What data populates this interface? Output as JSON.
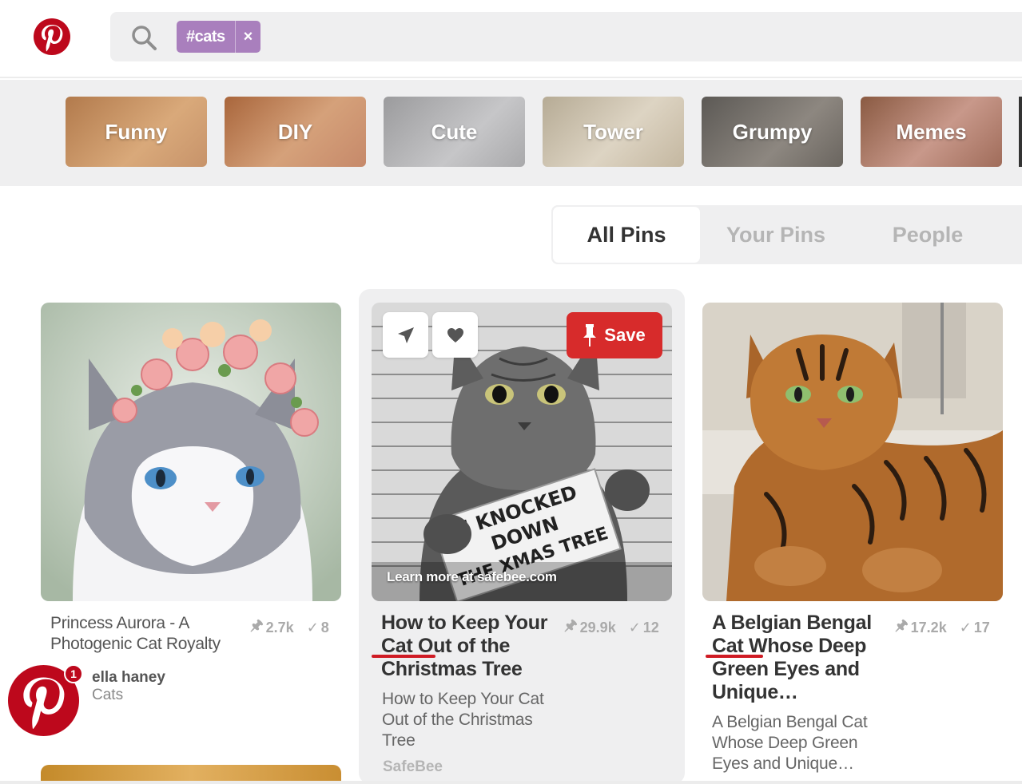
{
  "colors": {
    "brand": "#bd081c",
    "chip": "#a97fbd",
    "save": "#d72b2b",
    "underline": "#cf1b24"
  },
  "search": {
    "chip_label": "#cats",
    "chip_remove": "×"
  },
  "guides": [
    {
      "label": "Funny",
      "bg": "linear-gradient(135deg,#b27a4c,#d9a97a 60%,#c7936a)"
    },
    {
      "label": "DIY",
      "bg": "linear-gradient(135deg,#a9663c,#d5a17a 55%,#c6896a)"
    },
    {
      "label": "Cute",
      "bg": "linear-gradient(135deg,#9b9b9d,#c6c6c8 60%,#a9a9ab)"
    },
    {
      "label": "Tower",
      "bg": "linear-gradient(135deg,#b6ab95,#ddd4c3 55%,#c4b7a0)"
    },
    {
      "label": "Grumpy",
      "bg": "linear-gradient(135deg,#5c5955,#8d8780 60%,#6a655f)"
    },
    {
      "label": "Memes",
      "bg": "linear-gradient(135deg,#8a5a42,#c8988a 55%,#a06c5a)"
    }
  ],
  "tabs": [
    {
      "label": "All Pins",
      "active": true
    },
    {
      "label": "Your Pins",
      "active": false
    },
    {
      "label": "People",
      "active": false
    }
  ],
  "pins": [
    {
      "title": "Princess Aurora - A Photogenic Cat Royalty",
      "saves": "2.7k",
      "checks": "8",
      "pinner": "ella haney",
      "board": "Cats"
    },
    {
      "title": "How to Keep Your Cat Out of the Christmas Tree",
      "saves": "29.9k",
      "checks": "12",
      "description": "How to Keep Your Cat Out of the Christmas Tree",
      "source": "SafeBee",
      "image_caption": "Learn more at safebee.com",
      "sign_text": [
        "I KNOCKED",
        "DOWN",
        "THE XMAS TREE"
      ],
      "save_label": "Save"
    },
    {
      "title": "A Belgian Bengal Cat Whose Deep Green Eyes and Unique…",
      "saves": "17.2k",
      "checks": "17",
      "description": "A Belgian Bengal Cat Whose Deep Green Eyes and Unique…"
    }
  ],
  "notification_count": "1"
}
